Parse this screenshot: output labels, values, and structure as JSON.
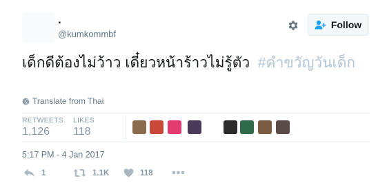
{
  "user": {
    "display_name": ".",
    "handle": "@kumkommbf"
  },
  "follow_button": {
    "label": "Follow"
  },
  "tweet": {
    "text": "เด็กดีต้องไม่ว้าว เดี๋ยวหน้าร้าวไม่รู้ตัว",
    "hashtag": "#คำขวัญวันเด็ก"
  },
  "translate": {
    "label": "Translate from Thai"
  },
  "stats": {
    "retweets_label": "RETWEETS",
    "retweets_value": "1,126",
    "likes_label": "LIKES",
    "likes_value": "118"
  },
  "likers": [
    {
      "icon": "avatar-1",
      "color": "#8a6b4e"
    },
    {
      "icon": "avatar-2",
      "color": "#c94a3a"
    },
    {
      "icon": "avatar-3",
      "color": "#e33b6f"
    },
    {
      "icon": "avatar-4",
      "color": "#4b3a5a"
    },
    {
      "icon": "avatar-5",
      "color": "#2c2c2c"
    },
    {
      "icon": "avatar-6",
      "color": "#2f6b4a"
    },
    {
      "icon": "avatar-7",
      "color": "#7b5c42"
    },
    {
      "icon": "avatar-8",
      "color": "#5a4a4a"
    }
  ],
  "timestamp": "5:17 PM - 4 Jan 2017",
  "actions": {
    "reply_count": "1",
    "retweet_count": "1.1K",
    "like_count": "118"
  },
  "colors": {
    "hashtag": "#b3c5d3",
    "muted": "#8899a6"
  }
}
